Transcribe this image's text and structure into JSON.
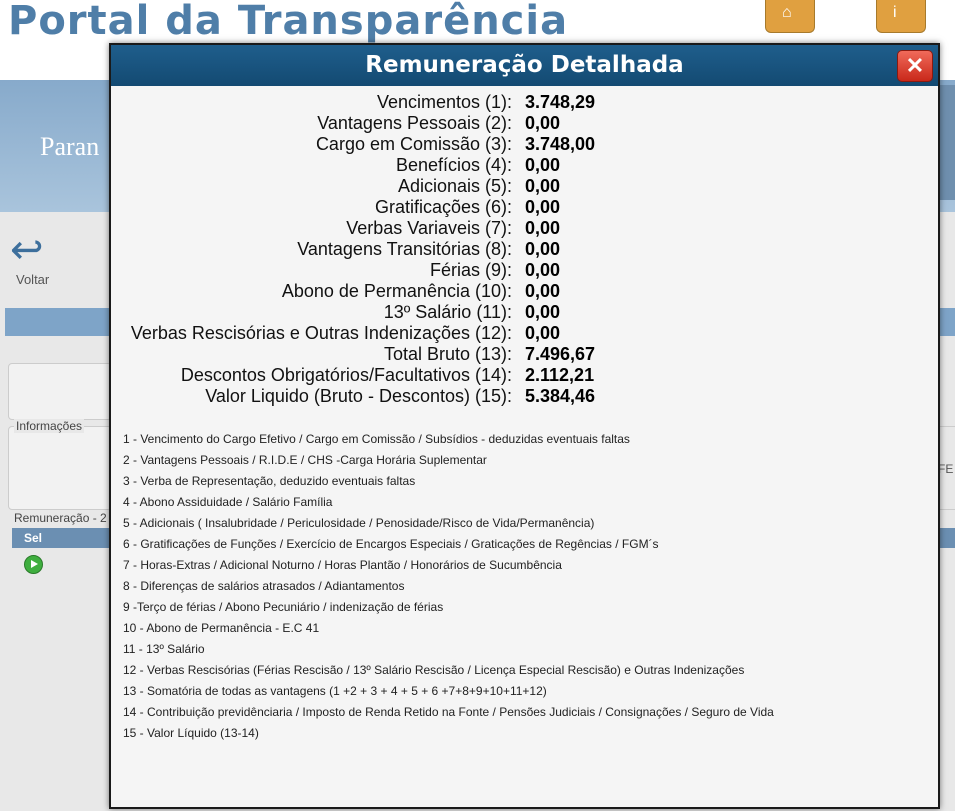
{
  "background": {
    "portal_title": "Portal da Transparência",
    "banner_text": "Paran",
    "back_label": "Voltar",
    "info_label": "Informações",
    "rem_label": "Remuneração - 2",
    "sel_label": "Sel",
    "right_fragment": "FE"
  },
  "modal": {
    "title": "Remuneração Detalhada",
    "close_glyph": "✕",
    "rows": [
      {
        "label": "Vencimentos (1):",
        "value": "3.748,29"
      },
      {
        "label": "Vantagens Pessoais (2):",
        "value": "0,00"
      },
      {
        "label": "Cargo em Comissão (3):",
        "value": "3.748,00"
      },
      {
        "label": "Benefícios (4):",
        "value": "0,00"
      },
      {
        "label": "Adicionais (5):",
        "value": "0,00"
      },
      {
        "label": "Gratificações (6):",
        "value": "0,00"
      },
      {
        "label": "Verbas Variaveis (7):",
        "value": "0,00"
      },
      {
        "label": "Vantagens Transitórias (8):",
        "value": "0,00"
      },
      {
        "label": "Férias (9):",
        "value": "0,00"
      },
      {
        "label": "Abono de Permanência (10):",
        "value": "0,00"
      },
      {
        "label": "13º Salário (11):",
        "value": "0,00"
      },
      {
        "label": "Verbas Rescisórias e Outras Indenizações (12):",
        "value": "0,00"
      },
      {
        "label": "Total Bruto (13):",
        "value": "7.496,67"
      },
      {
        "label": "Descontos Obrigatórios/Facultativos (14):",
        "value": "2.112,21"
      },
      {
        "label": "Valor Liquido (Bruto - Descontos) (15):",
        "value": "5.384,46"
      }
    ],
    "notes": [
      "1 - Vencimento do Cargo Efetivo / Cargo em Comissão / Subsídios - deduzidas eventuais faltas",
      "2 - Vantagens Pessoais / R.I.D.E / CHS -Carga Horária Suplementar",
      "3 - Verba de Representação, deduzido eventuais faltas",
      "4 - Abono Assiduidade / Salário Família",
      "5 - Adicionais ( Insalubridade / Periculosidade / Penosidade/Risco de Vida/Permanência)",
      "6 - Gratificações de Funções / Exercício de Encargos Especiais / Graticações de Regências / FGM´s",
      "7 - Horas-Extras / Adicional Noturno / Horas Plantão / Honorários de Sucumbência",
      "8 - Diferenças de salários atrasados / Adiantamentos",
      "9 -Terço de férias / Abono Pecuniário / indenização de férias",
      "10 - Abono de Permanência - E.C 41",
      "11 - 13º Salário",
      "12 - Verbas Rescisórias (Férias Rescisão / 13º Salário Rescisão / Licença Especial Rescisão) e Outras Indenizações",
      "13 - Somatória de todas as vantagens (1 +2 + 3 + 4 + 5 + 6 +7+8+9+10+11+12)",
      "14 - Contribuição previdênciaria / Imposto de Renda Retido na Fonte / Pensões Judiciais / Consignações / Seguro de Vida",
      "15 - Valor Líquido (13-14)"
    ]
  }
}
